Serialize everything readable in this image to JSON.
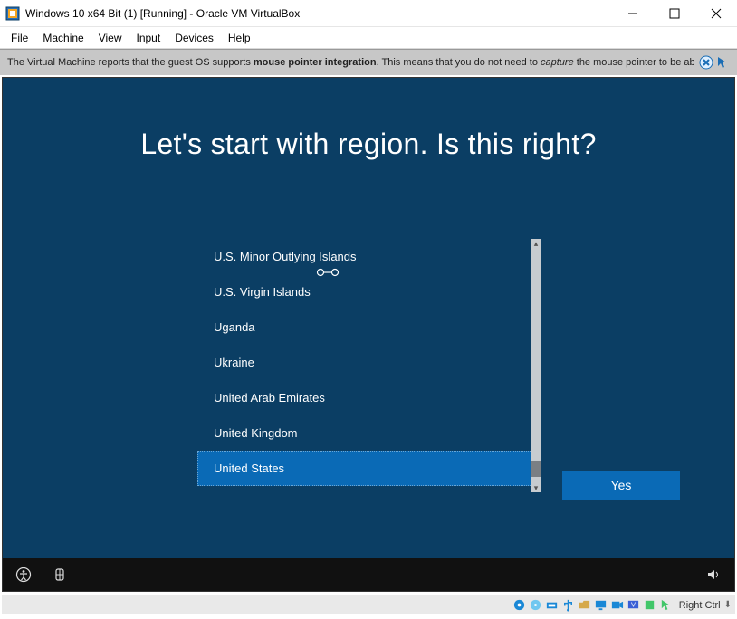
{
  "titlebar": {
    "app_title": "Windows 10 x64 Bit (1) [Running] - Oracle VM VirtualBox"
  },
  "menubar": {
    "items": [
      "File",
      "Machine",
      "View",
      "Input",
      "Devices",
      "Help"
    ]
  },
  "infobar": {
    "prefix": "The Virtual Machine reports that the guest OS supports ",
    "bold": "mouse pointer integration",
    "mid": ". This means that you do not need to ",
    "italic": "capture",
    "suffix": " the mouse pointer to be able to"
  },
  "oobe": {
    "title": "Let's start with region. Is this right?",
    "regions": [
      "U.S. Minor Outlying Islands",
      "U.S. Virgin Islands",
      "Uganda",
      "Ukraine",
      "United Arab Emirates",
      "United Kingdom",
      "United States"
    ],
    "selected_index": 6,
    "yes_label": "Yes"
  },
  "vb_status": {
    "host_key": "Right Ctrl"
  }
}
